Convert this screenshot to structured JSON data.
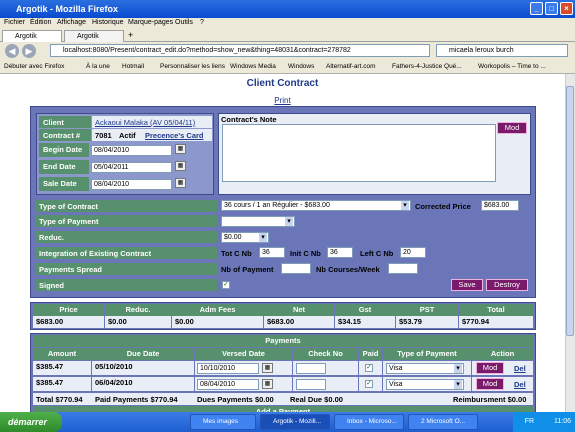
{
  "window": {
    "title": "Argotik - Mozilla Firefox"
  },
  "menu": [
    "Fichier",
    "Édition",
    "Affichage",
    "Historique",
    "Marque-pages",
    "Outils",
    "?"
  ],
  "tabs": [
    "Argotik",
    "Argotik"
  ],
  "nav": {
    "url": "localhost:8080/Present/contract_edit.do?method=show_new&thing=48031&contract=278782",
    "search": "micaela leroux burch"
  },
  "bookmarks": [
    "Débuter avec Firefox",
    "À la une",
    "Hotmail",
    "Personnaliser les liens",
    "Windows Media",
    "Windows",
    "Alternatif-art.com",
    "Fathers-4-Justice Qué...",
    "Workopolis – Time to ..."
  ],
  "page": {
    "title": "Client Contract",
    "print": "Print"
  },
  "client": {
    "client_label": "Client",
    "client_value": "Ackaoui Malaka (AV 05/04/11)",
    "contract_label": "Contract #",
    "contract_no": "7081",
    "status": "Actif",
    "card": "Precence's Card",
    "begin_label": "Begin Date",
    "begin_value": "08/04/2010",
    "end_label": "End Date",
    "end_value": "05/04/2011",
    "sale_label": "Sale Date",
    "sale_value": "08/04/2010",
    "note_label": "Contract's Note",
    "mod": "Mod"
  },
  "contract": {
    "type_label": "Type of Contract",
    "type_value": "36 cours / 1 an Régulier - $683.00",
    "corrected_label": "Corrected Price",
    "corrected_value": "$683.00",
    "payment_type_label": "Type of Payment",
    "payment_type_value": "",
    "reduc_label": "Reduc.",
    "reduc_value": "$0.00",
    "integration_label": "Integration of Existing Contract",
    "tot_label": "Tot C Nb",
    "tot_value": "36",
    "init_label": "Init C Nb",
    "init_value": "36",
    "left_label": "Left C Nb",
    "left_value": "20",
    "spread_label": "Payments Spread",
    "nbpay_label": "Nb of Payment",
    "nbpay_value": "",
    "nbcourses_label": "Nb Courses/Week",
    "nbcourses_value": "",
    "signed_label": "Signed",
    "save": "Save",
    "destroy": "Destroy"
  },
  "totals": {
    "headers": [
      "Price",
      "Reduc.",
      "Adm Fees",
      "Net",
      "Gst",
      "PST",
      "Total"
    ],
    "values": [
      "$683.00",
      "$0.00",
      "$0.00",
      "$683.00",
      "$34.15",
      "$53.79",
      "$770.94"
    ]
  },
  "payments": {
    "title": "Payments",
    "headers": [
      "Amount",
      "Due Date",
      "Versed Date",
      "Check No",
      "Paid",
      "Type of Payment",
      "Action"
    ],
    "rows": [
      {
        "amount": "$385.47",
        "due": "05/10/2010",
        "versed": "10/10/2010",
        "check": "",
        "type": "Visa",
        "mod": "Mod",
        "del": "Del"
      },
      {
        "amount": "$385.47",
        "due": "06/04/2010",
        "versed": "08/04/2010",
        "check": "",
        "type": "Visa",
        "mod": "Mod",
        "del": "Del"
      }
    ],
    "summary": {
      "total": "Total $770.94",
      "paid": "Paid Payments $770.94",
      "dues": "Dues Payments $0.00",
      "real": "Real Due $0.00",
      "reimb": "Reimbursment $0.00"
    },
    "add": "Add a Payment"
  },
  "taskbar": {
    "start": "démarrer",
    "items": [
      "Mes images",
      "Argotik - Mozill...",
      "Inbox - Microso...",
      "2 Microsoft O..."
    ],
    "lang": "FR",
    "time": "11:06"
  }
}
